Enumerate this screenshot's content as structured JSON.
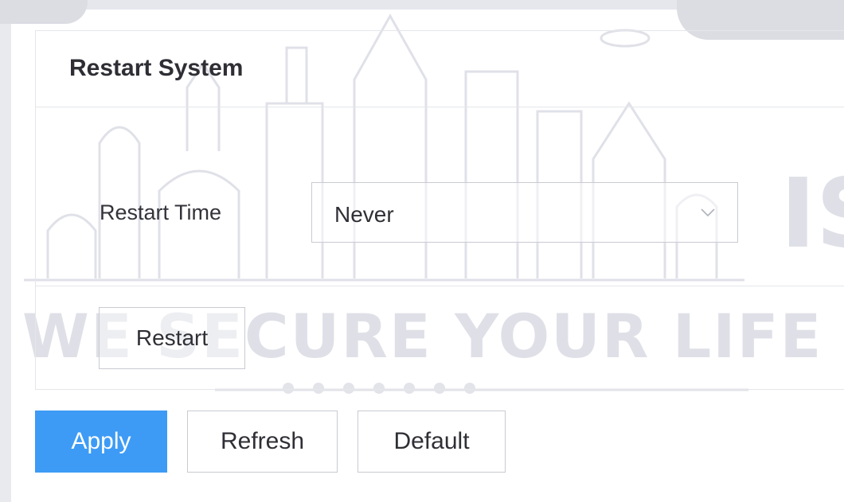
{
  "panel": {
    "title": "Restart System"
  },
  "restart_time": {
    "label": "Restart Time",
    "selected": "Never"
  },
  "actions": {
    "restart_label": "Restart"
  },
  "footer": {
    "apply_label": "Apply",
    "refresh_label": "Refresh",
    "default_label": "Default"
  },
  "watermark": {
    "slogan": "WE SECURE YOUR LIFE",
    "brand_fragment": "IS"
  },
  "colors": {
    "accent": "#3d9bf5",
    "border": "#c9cbd2",
    "text": "#2f2f36"
  },
  "icons": {
    "select_arrow": "chevron-down-icon"
  }
}
